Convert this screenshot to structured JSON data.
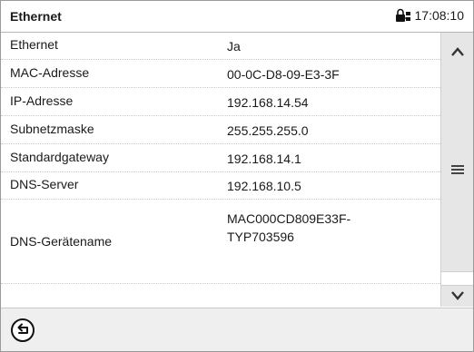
{
  "header": {
    "title": "Ethernet",
    "time": "17:08:10",
    "lock_icon": "network-lock-icon"
  },
  "rows": [
    {
      "label": "Ethernet",
      "value": "Ja"
    },
    {
      "label": "MAC-Adresse",
      "value": "00-0C-D8-09-E3-3F"
    },
    {
      "label": "IP-Adresse",
      "value": "192.168.14.54"
    },
    {
      "label": "Subnetzmaske",
      "value": "255.255.255.0"
    },
    {
      "label": "Standardgateway",
      "value": "192.168.14.1"
    },
    {
      "label": "DNS-Server",
      "value": "192.168.10.5"
    },
    {
      "label": "DNS-Gerätename",
      "value_line1": "MAC000CD809E33F-",
      "value_line2": "TYP703596"
    }
  ],
  "scroll": {
    "up_icon": "chevron-up-icon",
    "menu_icon": "menu-icon",
    "down_icon": "chevron-down-icon"
  },
  "footer": {
    "back_icon": "back-icon"
  }
}
